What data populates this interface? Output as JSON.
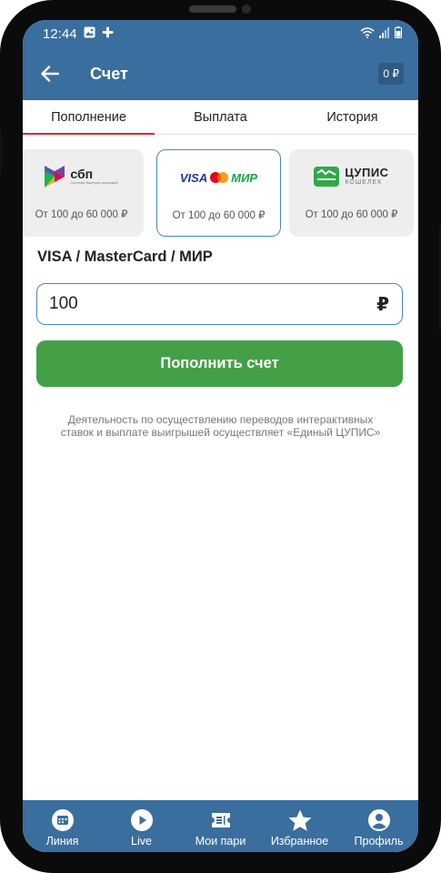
{
  "status": {
    "time": "12:44"
  },
  "appbar": {
    "title": "Счет",
    "balance": "0 ₽"
  },
  "tabs": [
    {
      "label": "Пополнение",
      "active": true
    },
    {
      "label": "Выплата",
      "active": false
    },
    {
      "label": "История",
      "active": false
    }
  ],
  "methods": [
    {
      "logo_text": "сбп",
      "logo_sub": "Система быстрых платежей",
      "range": "От 100 до 60 000 ₽",
      "selected": false
    },
    {
      "logo_text": "VISA",
      "logo_text2": "МИР",
      "range": "От 100 до 60 000 ₽",
      "selected": true
    },
    {
      "logo_text": "ЦУПИС",
      "logo_sub": "КОШЕЛЕК",
      "range": "От 100 до 60 000 ₽",
      "selected": false
    }
  ],
  "section_title": "VISA / MasterCard / МИР",
  "amount": {
    "value": "100",
    "currency": "₽"
  },
  "topup_button": "Пополнить счет",
  "disclaimer": "Деятельность по осуществлению переводов интерактивных ставок и выплате выигрышей осуществляет «Единый ЦУПИС»",
  "bottom_nav": [
    {
      "label": "Линия",
      "icon": "calendar-icon"
    },
    {
      "label": "Live",
      "icon": "play-icon"
    },
    {
      "label": "Мои пари",
      "icon": "ticket-icon"
    },
    {
      "label": "Избранное",
      "icon": "star-icon"
    },
    {
      "label": "Профиль",
      "icon": "profile-icon"
    }
  ],
  "colors": {
    "primary": "#3a6e9e",
    "accent_red": "#d32f2f",
    "button_green": "#43a047",
    "field_border": "#4a87b8"
  }
}
